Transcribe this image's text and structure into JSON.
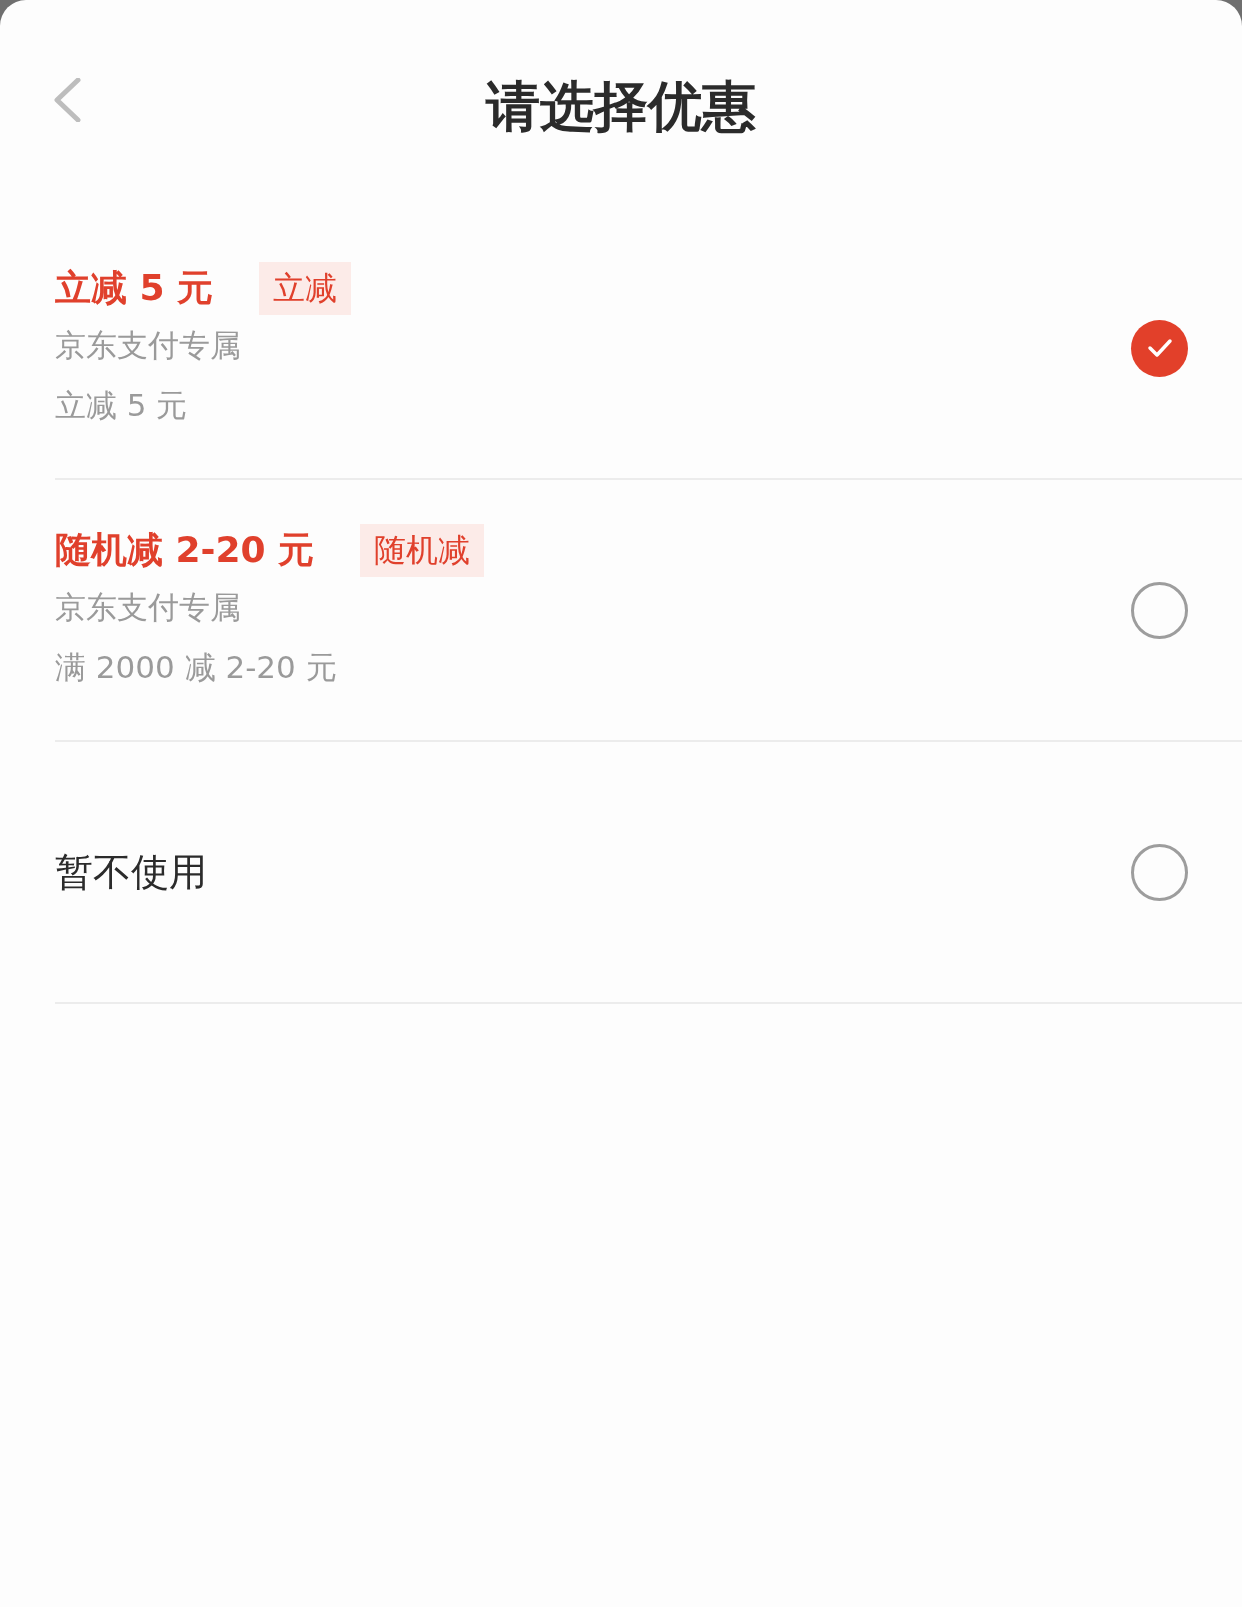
{
  "header": {
    "title": "请选择优惠"
  },
  "options": [
    {
      "kind": "coupon",
      "title": "立减 5 元",
      "tag": "立减",
      "lines": [
        "京东支付专属",
        "立减 5 元"
      ],
      "selected": true
    },
    {
      "kind": "coupon",
      "title": "随机减 2-20 元",
      "tag": "随机减",
      "lines": [
        "京东支付专属",
        "满 2000 减 2-20 元"
      ],
      "selected": false
    },
    {
      "kind": "none",
      "title": "暂不使用",
      "selected": false
    }
  ]
}
